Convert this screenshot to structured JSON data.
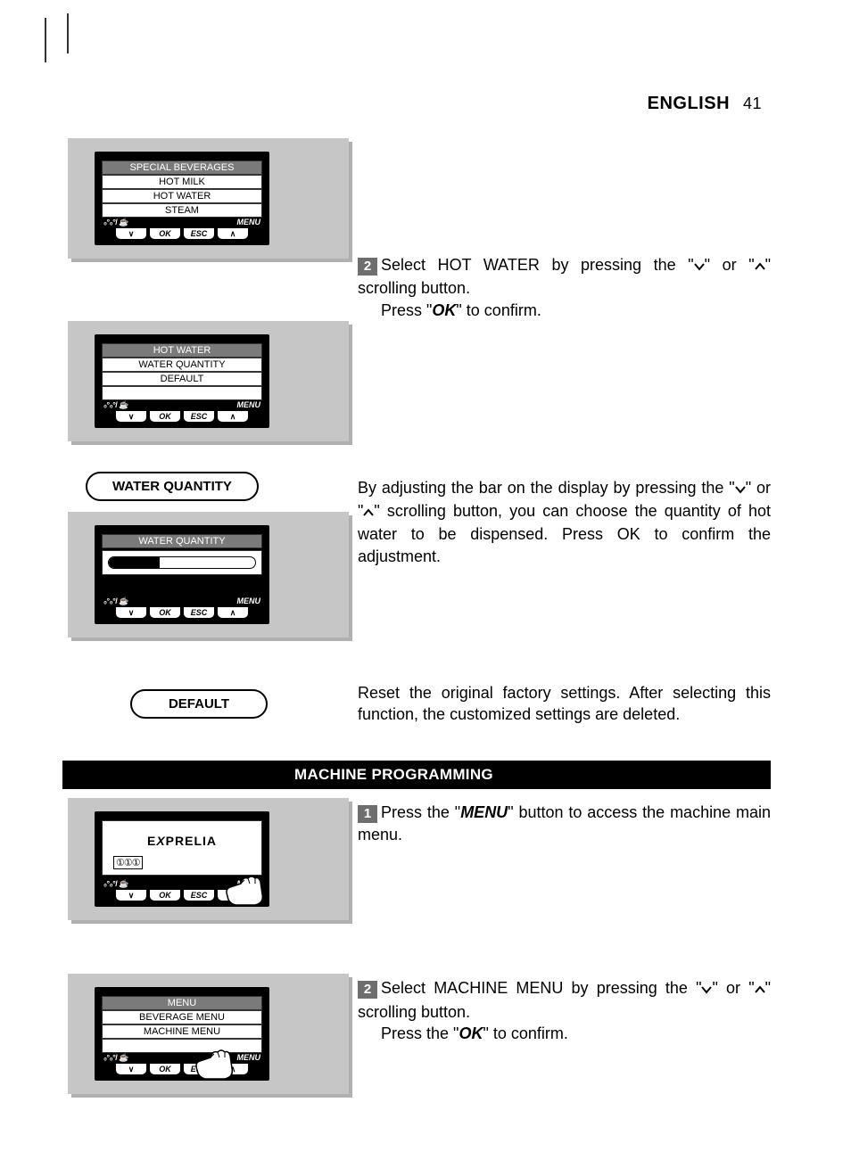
{
  "header": {
    "language": "ENGLISH",
    "page_number": "41"
  },
  "btn_labels": {
    "down": "∨",
    "ok": "OK",
    "esc": "ESC",
    "up": "∧",
    "strength": "⦾⦾⦾⦾",
    "menu": "MENU"
  },
  "lcd1": {
    "title": "SPECIAL BEVERAGES",
    "items": [
      "HOT MILK",
      "HOT WATER",
      "STEAM"
    ]
  },
  "lcd2": {
    "title": "HOT WATER",
    "items": [
      "WATER QUANTITY",
      "DEFAULT"
    ]
  },
  "pill_water_quantity": "WATER QUANTITY",
  "lcd3": {
    "title": "WATER QUANTITY",
    "progress_pct": 35
  },
  "pill_default": "DEFAULT",
  "lcd4": {
    "brand": "EXPRELIA",
    "cups": "①①①"
  },
  "lcd5": {
    "title": "MENU",
    "items": [
      "BEVERAGE MENU",
      "MACHINE MENU"
    ]
  },
  "section_heading": "MACHINE PROGRAMMING",
  "step2a": {
    "num": "2",
    "pre": "Select HOT WATER by pressing the \"",
    "mid1": "\" or \"",
    "mid2": "\" scrolling button.",
    "line2a": "Press \"",
    "ok": "OK",
    "line2b": "\" to confirm."
  },
  "para_wq": {
    "pre": "By adjusting the bar on the display by pressing the \"",
    "mid1": "\" or \"",
    "mid2": "\" scrolling button, you can choose the quantity of hot water to be dispensed. Press OK to confirm the adjustment."
  },
  "para_default": "Reset the original factory settings. After selecting this function, the customized settings are deleted.",
  "step1b": {
    "num": "1",
    "pre": "Press the \"",
    "menu": "MENU",
    "post": "\" button to access the machine main menu."
  },
  "step2b": {
    "num": "2",
    "pre": "Select MACHINE MENU by pressing the \"",
    "mid1": "\" or \"",
    "mid2": "\" scrolling button.",
    "line2a": "Press the \"",
    "ok": "OK",
    "line2b": "\" to confirm."
  }
}
